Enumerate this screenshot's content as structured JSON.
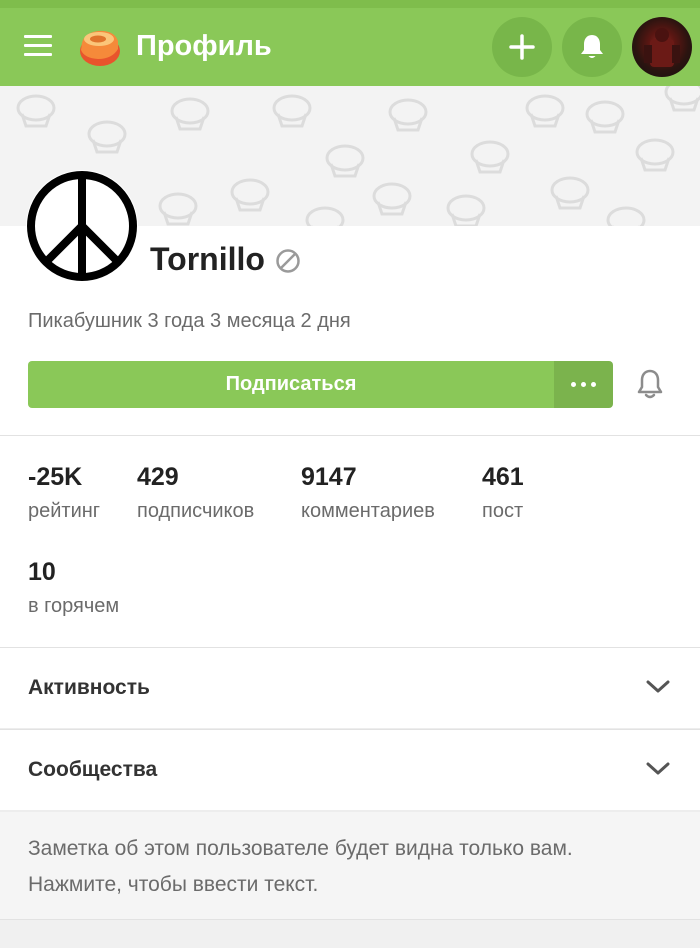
{
  "header": {
    "title": "Профиль",
    "menu_icon": "hamburger-icon",
    "logo_icon": "pikabu-logo",
    "add_icon": "plus-icon",
    "notifications_icon": "bell-icon"
  },
  "profile": {
    "username": "Tornillo",
    "status_icon": "ban-icon",
    "tenure": "Пикабушник 3 года 3 месяца 2 дня",
    "subscribe_label": "Подписаться",
    "more_icon": "more-dots-icon",
    "bell_icon": "bell-outline-icon"
  },
  "stats": [
    {
      "value": "-25K",
      "label": "рейтинг"
    },
    {
      "value": "429",
      "label": "подписчиков"
    },
    {
      "value": "9147",
      "label": "комментариев"
    },
    {
      "value": "461",
      "label": "пост"
    },
    {
      "value": "10",
      "label": "в горячем"
    }
  ],
  "sections": [
    {
      "label": "Активность",
      "icon": "chevron-down-icon"
    },
    {
      "label": "Сообщества",
      "icon": "chevron-down-icon"
    }
  ],
  "note": "Заметка об этом пользователе будет видна только вам. Нажмите, чтобы ввести текст.",
  "colors": {
    "accent": "#8ac858",
    "accent_dark": "#78b64a",
    "text_muted": "#6b6b6b"
  }
}
